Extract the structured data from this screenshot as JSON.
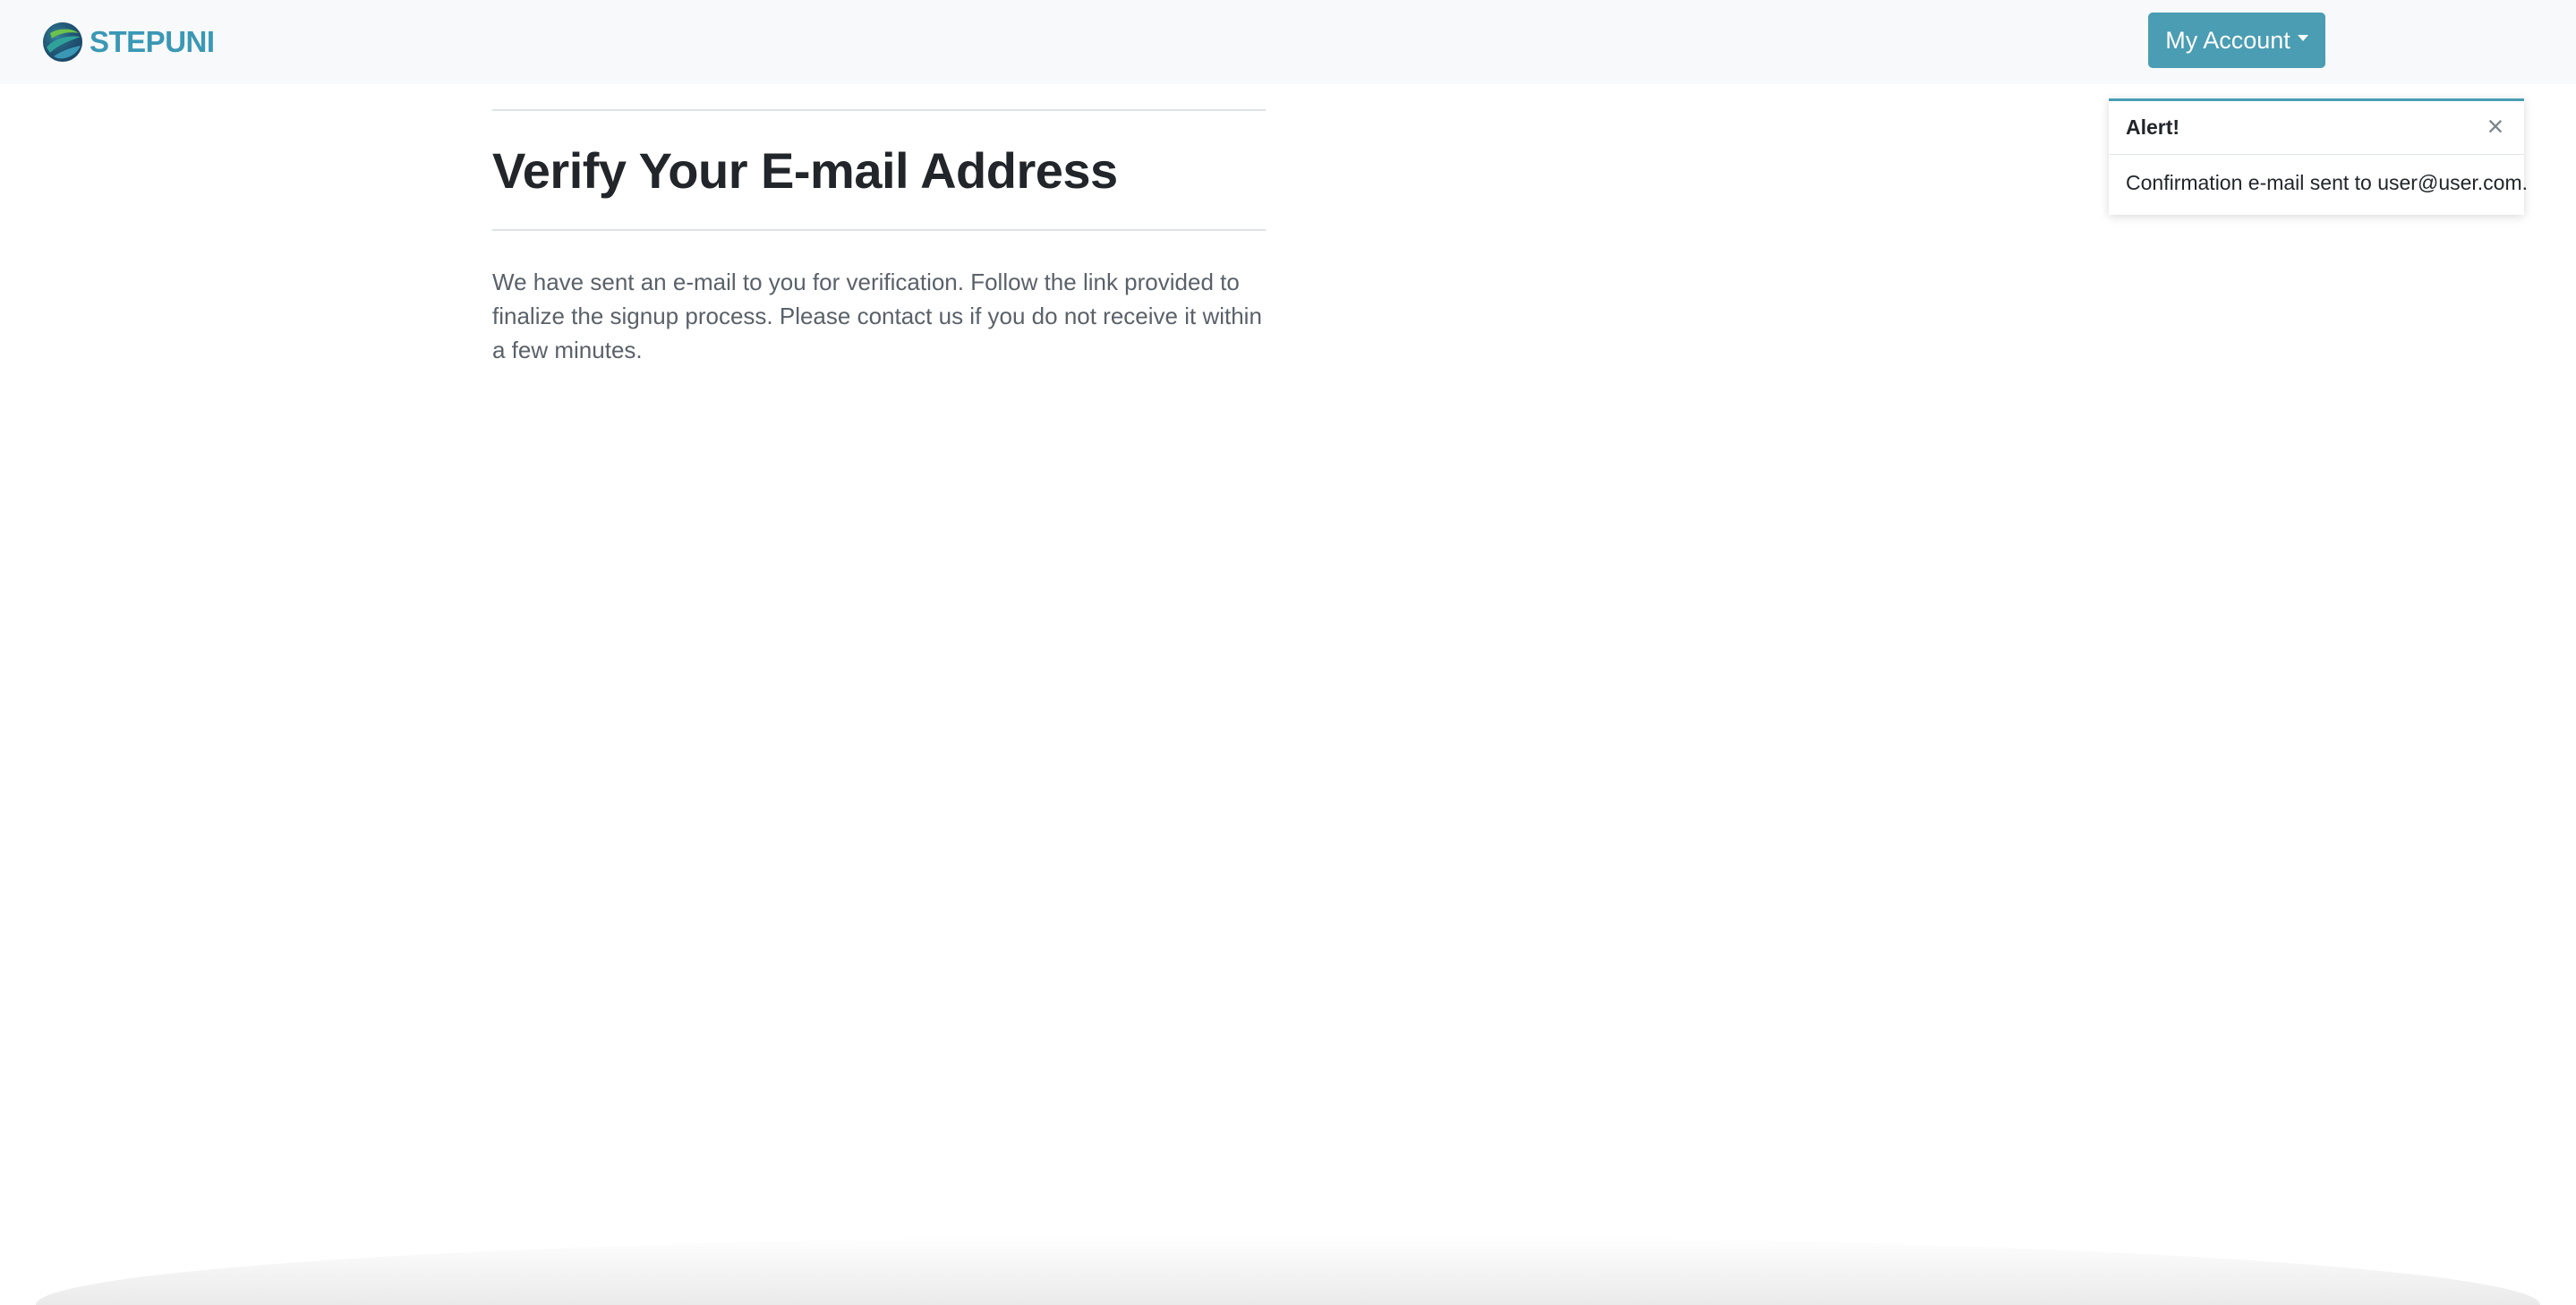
{
  "brand": {
    "name": "STEPUNI",
    "logo_icon": "globe-swoosh-icon",
    "color": "#3a98b5"
  },
  "navbar": {
    "account_button_label": "My Account",
    "account_button_color": "#4a9db3"
  },
  "main": {
    "title": "Verify Your E-mail Address",
    "message": "We have sent an e-mail to you for verification. Follow the link provided to finalize the signup process. Please contact us if you do not receive it within a few minutes."
  },
  "toast": {
    "title": "Alert!",
    "close_icon": "close-icon",
    "message": "Confirmation e-mail sent to user@user.com."
  }
}
